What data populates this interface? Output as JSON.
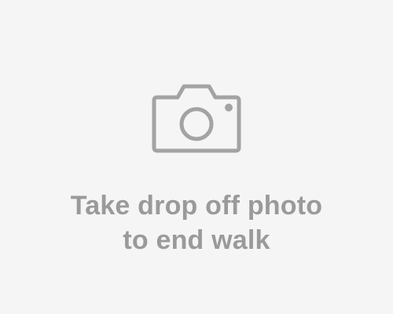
{
  "capture": {
    "icon": "camera-icon",
    "prompt_line_1": "Take drop off photo",
    "prompt_line_2": "to end walk"
  },
  "colors": {
    "background": "#f5f5f5",
    "icon": "#a3a3a3",
    "text": "#9a9a9a"
  }
}
